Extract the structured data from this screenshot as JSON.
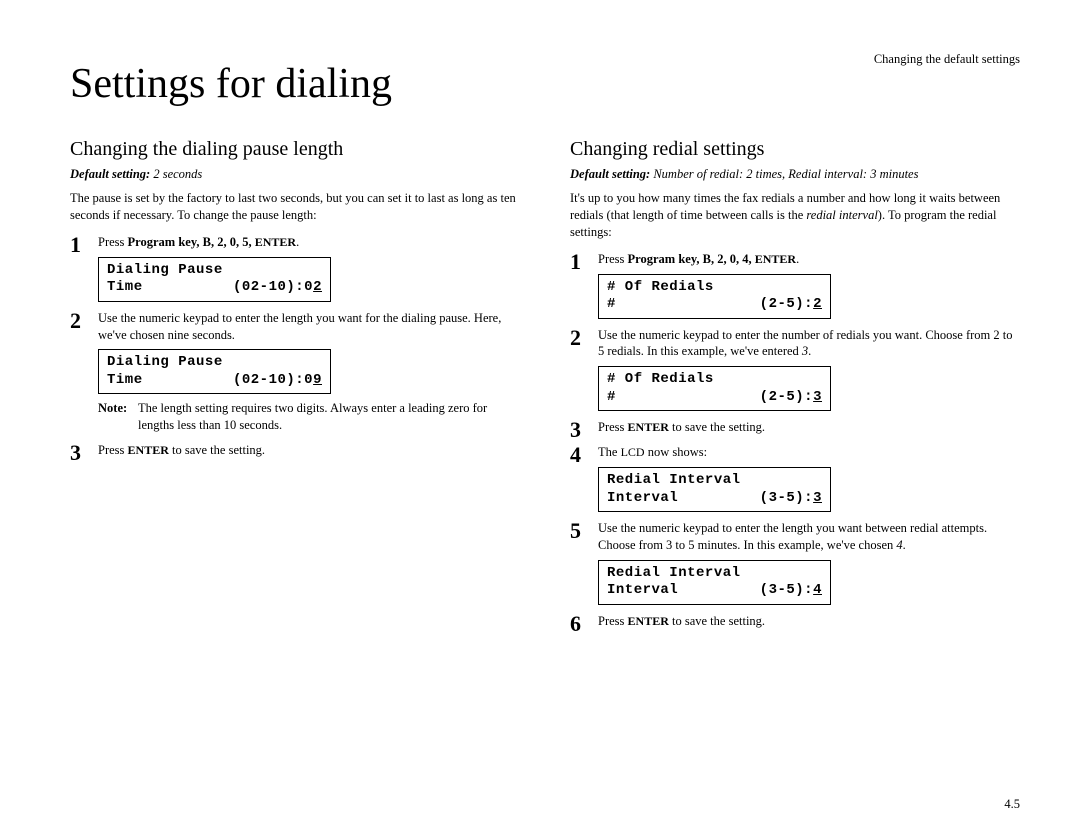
{
  "breadcrumb": "Changing the default settings",
  "title": "Settings for dialing",
  "pagenum": "4.5",
  "left": {
    "heading": "Changing the dialing pause length",
    "default_label": "Default setting:",
    "default_value": "2 seconds",
    "intro": "The pause is set by the factory to last two seconds, but you can set it to last as long as ten seconds if necessary. To change the pause length:",
    "step1_prefix": "Press ",
    "step1_keys": "Program key, B, 2, 0, 5, ",
    "step1_enter": "ENTER",
    "step1_suffix": ".",
    "lcd1_line1": "Dialing Pause",
    "lcd1_line2a": "Time",
    "lcd1_line2b_pre": "(02-10):0",
    "lcd1_line2b_cur": "2",
    "step2": "Use the numeric keypad to enter the length you want for the dialing pause. Here, we've chosen nine seconds.",
    "lcd2_line1": "Dialing Pause",
    "lcd2_line2a": "Time",
    "lcd2_line2b_pre": "(02-10):0",
    "lcd2_line2b_cur": "9",
    "note_label": "Note:",
    "note_text": "The length setting requires two digits. Always enter a leading zero for lengths less than 10 seconds.",
    "step3_prefix": "Press ",
    "step3_enter": "ENTER",
    "step3_suffix": " to save the setting."
  },
  "right": {
    "heading": "Changing redial settings",
    "default_label": "Default setting:",
    "default_value": "Number of redial: 2 times, Redial interval: 3 minutes",
    "intro_a": "It's up to you how many times the fax redials a number and how long it waits between redials (that length of time between calls is the ",
    "intro_em": "redial interval",
    "intro_b": "). To program the redial settings:",
    "step1_prefix": "Press ",
    "step1_keys": "Program key, B, 2, 0, 4, ",
    "step1_enter": "ENTER",
    "step1_suffix": ".",
    "lcd1_line1": "# Of Redials",
    "lcd1_line2a": "#",
    "lcd1_line2b_pre": "(2-5):",
    "lcd1_line2b_cur": "2",
    "step2_a": "Use the numeric keypad to enter the number of redials you want. Choose from 2 to 5 redials. In this example, we've entered ",
    "step2_em": "3",
    "step2_b": ".",
    "lcd2_line1": "# Of Redials",
    "lcd2_line2a": "#",
    "lcd2_line2b_pre": "(2-5):",
    "lcd2_line2b_cur": "3",
    "step3_prefix": "Press ",
    "step3_enter": "ENTER",
    "step3_suffix": " to save the setting.",
    "step4_a": "The ",
    "step4_lcd": "LCD",
    "step4_b": " now shows:",
    "lcd3_line1": "Redial Interval",
    "lcd3_line2a": "Interval",
    "lcd3_line2b_pre": "(3-5):",
    "lcd3_line2b_cur": "3",
    "step5_a": "Use the numeric keypad to enter the length you want between redial attempts. Choose from 3 to 5 minutes. In this example, we've chosen ",
    "step5_em": "4",
    "step5_b": ".",
    "lcd4_line1": "Redial Interval",
    "lcd4_line2a": "Interval",
    "lcd4_line2b_pre": "(3-5):",
    "lcd4_line2b_cur": "4",
    "step6_prefix": "Press ",
    "step6_enter": "ENTER",
    "step6_suffix": " to save the setting."
  }
}
